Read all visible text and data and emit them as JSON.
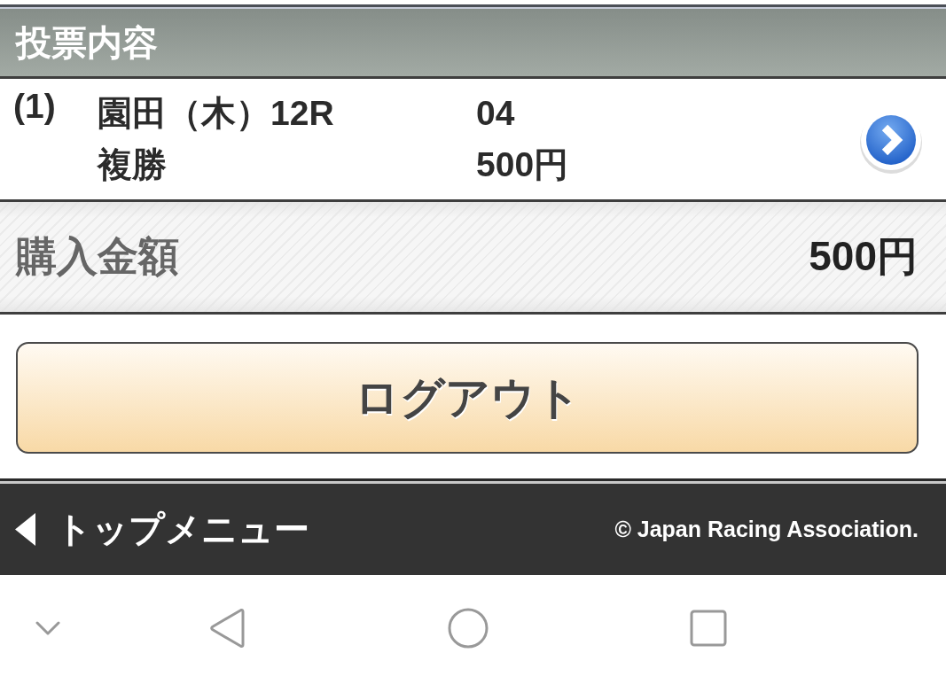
{
  "header": {
    "title": "投票内容"
  },
  "bets": [
    {
      "number": "(1)",
      "race": "園田（木）12R",
      "selection": "04",
      "bet_type": "複勝",
      "amount": "500円"
    }
  ],
  "total": {
    "label": "購入金額",
    "amount": "500円"
  },
  "logout_button": {
    "label": "ログアウト"
  },
  "footer": {
    "back_link": "トップメニュー",
    "copyright": "© Japan Racing Association."
  }
}
